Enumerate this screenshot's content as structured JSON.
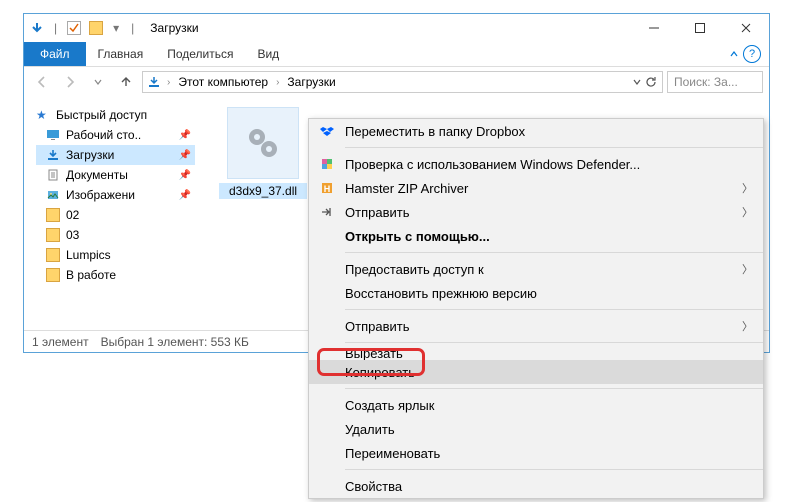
{
  "window": {
    "title": "Загрузки"
  },
  "ribbon": {
    "file": "Файл",
    "tabs": [
      "Главная",
      "Поделиться",
      "Вид"
    ]
  },
  "address": {
    "segments": [
      "Этот компьютер",
      "Загрузки"
    ],
    "search_placeholder": "Поиск: За..."
  },
  "sidebar": {
    "quick": "Быстрый доступ",
    "items": [
      {
        "label": "Рабочий сто..",
        "pin": true,
        "icon": "desktop"
      },
      {
        "label": "Загрузки",
        "pin": true,
        "icon": "downloads",
        "active": true
      },
      {
        "label": "Документы",
        "pin": true,
        "icon": "documents"
      },
      {
        "label": "Изображени",
        "pin": true,
        "icon": "pictures"
      },
      {
        "label": "02",
        "pin": false,
        "icon": "folder"
      },
      {
        "label": "03",
        "pin": false,
        "icon": "folder"
      },
      {
        "label": "Lumpics",
        "pin": false,
        "icon": "folder"
      },
      {
        "label": "В работе",
        "pin": false,
        "icon": "folder"
      }
    ]
  },
  "content": {
    "file_name": "d3dx9_37.dll"
  },
  "status": {
    "count": "1 элемент",
    "selection": "Выбран 1 элемент: 553 КБ"
  },
  "context_menu": {
    "items": [
      {
        "label": "Переместить в папку Dropbox",
        "icon": "dropbox"
      },
      {
        "sep": true
      },
      {
        "label": "Проверка с использованием Windows Defender...",
        "icon": "defender"
      },
      {
        "label": "Hamster ZIP Archiver",
        "icon": "hamster",
        "sub": true
      },
      {
        "label": "Отправить",
        "icon": "share",
        "sub": true
      },
      {
        "label": "Открыть с помощью...",
        "bold": true,
        "noicon": true
      },
      {
        "sep": true
      },
      {
        "label": "Предоставить доступ к",
        "noicon": true,
        "sub": true
      },
      {
        "label": "Восстановить прежнюю версию",
        "noicon": true
      },
      {
        "sep": true
      },
      {
        "label": "Отправить",
        "noicon": true,
        "sub": true
      },
      {
        "sep": true
      },
      {
        "label": "Вырезать",
        "noicon": true,
        "cut": true
      },
      {
        "label": "Копировать",
        "noicon": true,
        "highlight": true
      },
      {
        "sep": true
      },
      {
        "label": "Создать ярлык",
        "noicon": true
      },
      {
        "label": "Удалить",
        "noicon": true
      },
      {
        "label": "Переименовать",
        "noicon": true
      },
      {
        "sep": true
      },
      {
        "label": "Свойства",
        "noicon": true
      }
    ]
  }
}
